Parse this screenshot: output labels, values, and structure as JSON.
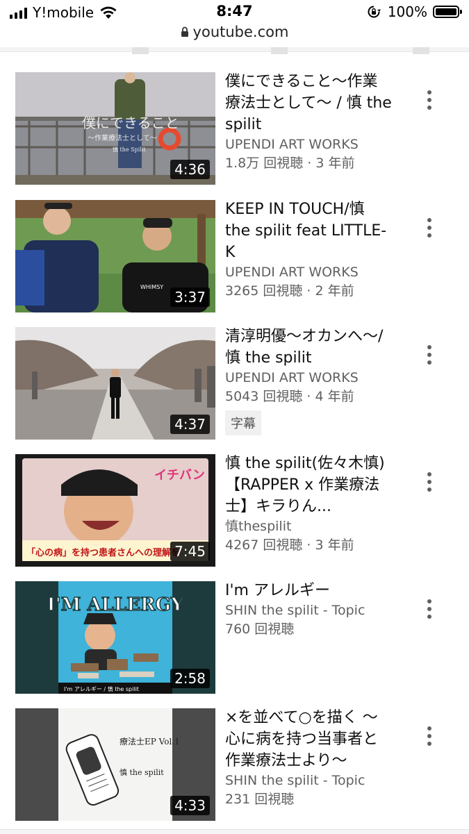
{
  "status_bar": {
    "carrier": "Y!mobile",
    "time": "8:47",
    "battery": "100%"
  },
  "url_bar": {
    "domain": "youtube.com"
  },
  "videos": [
    {
      "title": "僕にできること〜作業療法士として〜 / 慎 the spilit",
      "channel": "UPENDI ART WORKS",
      "stats": "1.8万 回視聴 · 3 年前",
      "duration": "4:36",
      "thumb_caption": "僕にできること",
      "thumb_subcaption": "〜作業療法士として〜",
      "thumb_credit": "慎 the Spilit"
    },
    {
      "title": "KEEP IN TOUCH/慎 the spilit feat LITTLE-K",
      "channel": "UPENDI ART WORKS",
      "stats": "3265 回視聴 · 2 年前",
      "duration": "3:37",
      "thumb_shirt": "WHIMSY"
    },
    {
      "title": "清淳明優〜オカンへ〜/慎 the spilit",
      "channel": "UPENDI ART WORKS",
      "stats": "5043 回視聴 · 4 年前",
      "duration": "4:37",
      "badge": "字幕"
    },
    {
      "title": "慎 the spilit(佐々木慎) 【RAPPER x 作業療法士】キラりん...",
      "channel": "慎thespilit",
      "stats": "4267 回視聴 · 3 年前",
      "duration": "7:45",
      "thumb_tv_title": "イチバン",
      "thumb_tv_caption": "「心の病」を持つ患者さんへの理解を"
    },
    {
      "title": "I'm アレルギー",
      "channel": "SHIN the spilit - Topic",
      "stats": "760 回視聴",
      "duration": "2:58",
      "thumb_heading": "I'M ALLERGY",
      "thumb_footer": "I'm アレルギー / 慎 the spilit"
    },
    {
      "title": "×を並べて○を描く 〜心に病を持つ当事者と作業療法士より〜",
      "channel": "SHIN the spilit - Topic",
      "stats": "231 回視聴",
      "duration": "4:33",
      "thumb_note": "療法士EP Vol.1",
      "thumb_credit": "慎 the spilit"
    }
  ],
  "colors": {
    "meta_text": "#606060",
    "duration_bg": "#000000",
    "background": "#ffffff"
  },
  "icons": [
    "signal-bars-icon",
    "wifi-icon",
    "orientation-lock-icon",
    "battery-icon",
    "padlock-icon",
    "more-vert-icon"
  ]
}
